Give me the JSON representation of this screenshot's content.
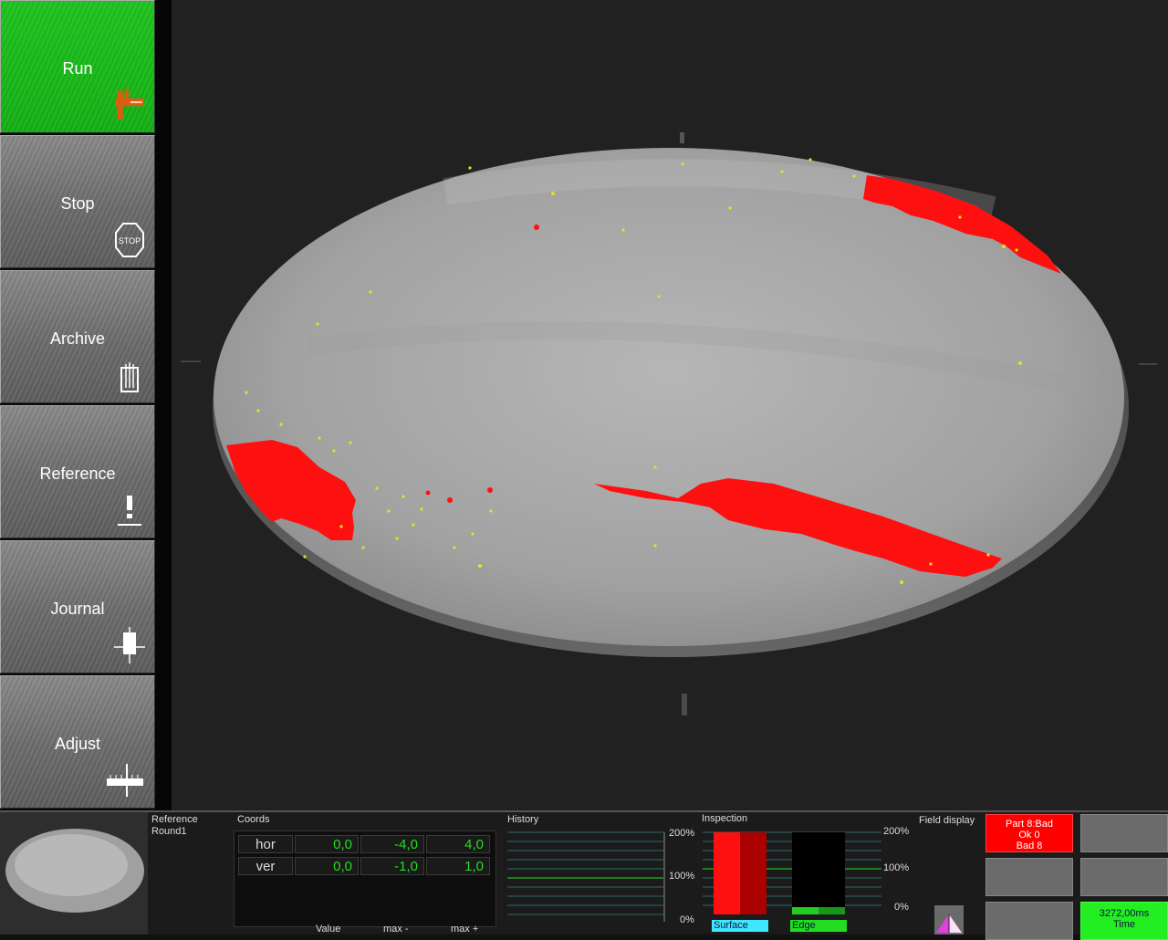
{
  "sidebar": {
    "items": [
      {
        "label": "Run",
        "active": true,
        "icon": "caliper-icon"
      },
      {
        "label": "Stop",
        "active": false,
        "icon": "stop-hexagon-icon"
      },
      {
        "label": "Archive",
        "active": false,
        "icon": "archive-box-icon"
      },
      {
        "label": "Reference",
        "active": false,
        "icon": "reference-exclamation-icon"
      },
      {
        "label": "Journal",
        "active": false,
        "icon": "journal-crosshair-icon"
      },
      {
        "label": "Adjust",
        "active": false,
        "icon": "ruler-icon"
      }
    ]
  },
  "colors": {
    "active_green": "#1fc41f",
    "defect_red": "#ff1010",
    "particle_yellow": "#e8e020",
    "value_green": "#22dd22",
    "surface_cyan": "#40e8ff",
    "status_bad_red": "#ff0000"
  },
  "reference": {
    "title": "Reference",
    "name": "Round1"
  },
  "coords": {
    "title": "Coords",
    "rows": [
      {
        "label": "hor",
        "value": "0,0",
        "min": "-4,0",
        "max": "4,0"
      },
      {
        "label": "ver",
        "value": "0,0",
        "min": "-1,0",
        "max": "1,0"
      }
    ],
    "footer": {
      "value": "Value",
      "min": "max -",
      "max": "max +"
    }
  },
  "history": {
    "title": "History",
    "ticks": [
      "200%",
      "100%",
      "0%"
    ]
  },
  "inspection": {
    "title": "Inspection",
    "ticks": [
      "200%",
      "100%",
      "0%"
    ],
    "surface": {
      "label": "Surface",
      "level": 1.0
    },
    "edge": {
      "label": "Edge",
      "level": 0.08
    }
  },
  "field_display": {
    "title": "Field display",
    "icon": "pyramid-triangle-icon"
  },
  "status": {
    "parts_line": "Part 8:Bad",
    "ok_line": "Ok 0",
    "bad_line": "Bad 8",
    "time_value": "3272,00ms",
    "time_label": "Time"
  }
}
